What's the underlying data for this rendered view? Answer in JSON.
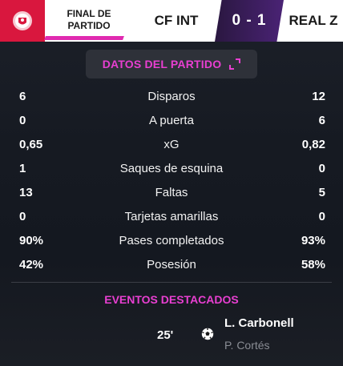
{
  "colors": {
    "accent": "#e83fd1",
    "logo_bg": "#d9173e",
    "score_bg": "#3a1d5c"
  },
  "header": {
    "logo_icon": "club-crest-icon",
    "status": "FINAL DE\nPARTIDO",
    "home_team": "CF INT",
    "score": "0 - 1",
    "away_team": "REAL Z"
  },
  "stats_section": {
    "title": "DATOS DEL PARTIDO",
    "expand_icon": "expand-icon",
    "rows": [
      {
        "home": "6",
        "label": "Disparos",
        "away": "12"
      },
      {
        "home": "0",
        "label": "A puerta",
        "away": "6"
      },
      {
        "home": "0,65",
        "label": "xG",
        "away": "0,82"
      },
      {
        "home": "1",
        "label": "Saques de esquina",
        "away": "0"
      },
      {
        "home": "13",
        "label": "Faltas",
        "away": "5"
      },
      {
        "home": "0",
        "label": "Tarjetas amarillas",
        "away": "0"
      },
      {
        "home": "90%",
        "label": "Pases completados",
        "away": "93%"
      },
      {
        "home": "42%",
        "label": "Posesión",
        "away": "58%"
      }
    ]
  },
  "events_section": {
    "title": "EVENTOS DESTACADOS",
    "events": [
      {
        "minute": "25'",
        "icon": "football-icon",
        "player": "L. Carbonell",
        "assist": "P. Cortés"
      }
    ]
  }
}
